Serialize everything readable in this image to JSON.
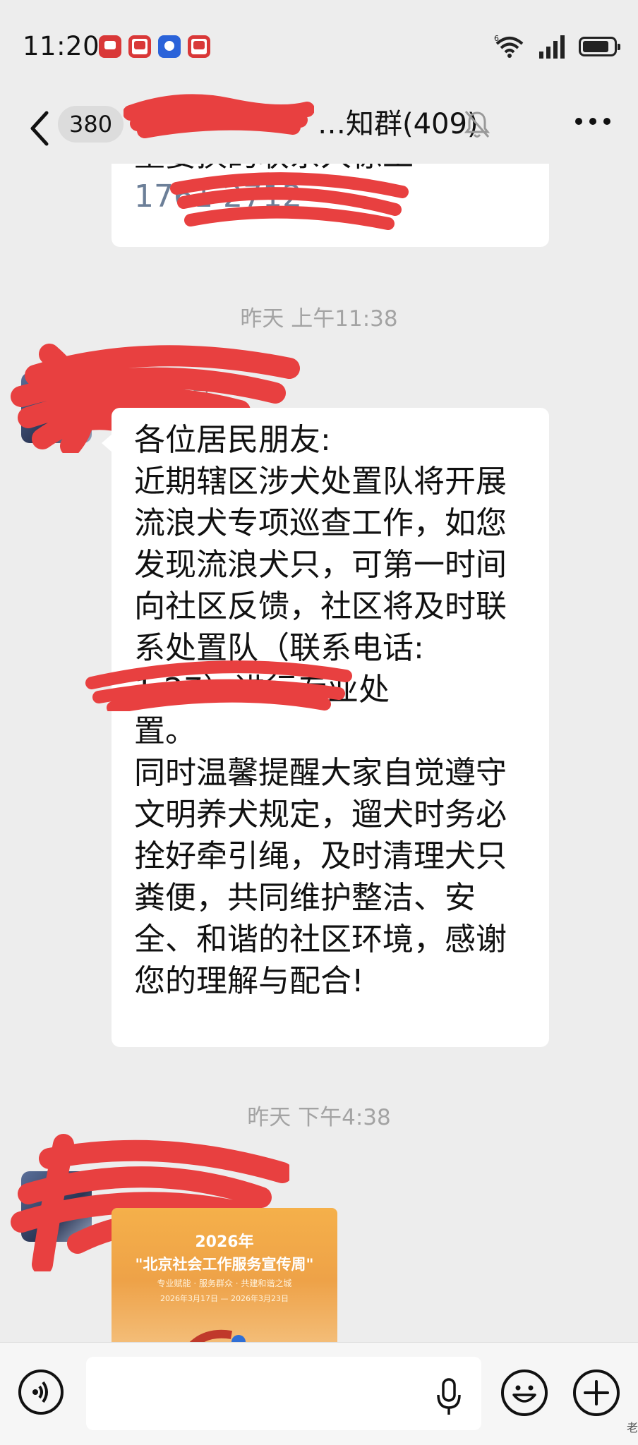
{
  "status_bar": {
    "time": "11:20",
    "notification_icons": [
      "app-notification-icon",
      "mail-icon",
      "bulb-icon",
      "mail-icon"
    ],
    "network_label": "6",
    "battery_level": 0.85
  },
  "nav": {
    "unread_count": "380",
    "chat_title": "…知群(409)",
    "muted": true
  },
  "messages": {
    "top_bubble": {
      "line1": "重要换的联系人徐工",
      "line2": "1761   2712"
    },
    "timestamp1": "昨天 上午11:38",
    "main_bubble": {
      "lines": [
        "各位居民朋友:",
        "近期辖区涉犬处置队将开展",
        "流浪犬专项巡查工作，如您",
        "发现流浪犬只，可第一时间",
        "向社区反馈，社区将及时联",
        "系处置队（联系电话:",
        "1            27）进行专业处",
        "置。",
        "同时温馨提醒大家自觉遵守",
        "文明养犬规定，遛犬时务必",
        "拴好牵引绳，及时清理犬只",
        "粪便，共同维护整洁、安",
        "全、和谐的社区环境，感谢",
        "您的理解与配合!"
      ]
    },
    "timestamp2": "昨天 下午4:38",
    "image_message": {
      "year": "2026年",
      "title": "\"北京社会工作服务宣传周\"",
      "subtitle": "专业赋能 · 服务群众 · 共建和谐之城",
      "dates": "2026年3月17日 — 2026年3月23日"
    }
  },
  "input_bar": {
    "placeholder": ""
  },
  "watermark": "老"
}
